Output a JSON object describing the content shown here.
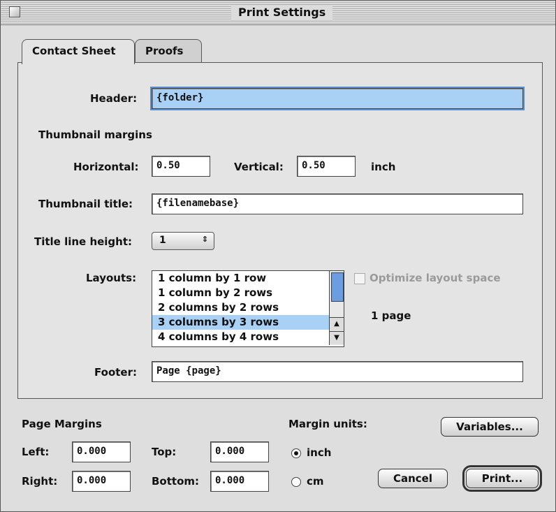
{
  "window": {
    "title": "Print Settings"
  },
  "tabs": [
    {
      "label": "Contact Sheet",
      "active": true
    },
    {
      "label": "Proofs",
      "active": false
    }
  ],
  "form": {
    "header_label": "Header:",
    "header_value": "{folder}",
    "thumb_margins_heading": "Thumbnail margins",
    "horizontal_label": "Horizontal:",
    "horizontal_value": "0.50",
    "vertical_label": "Vertical:",
    "vertical_value": "0.50",
    "margin_unit": "inch",
    "thumb_title_label": "Thumbnail title:",
    "thumb_title_value": "{filenamebase}",
    "title_line_height_label": "Title line height:",
    "title_line_height_value": "1",
    "layouts_label": "Layouts:",
    "layouts": [
      "1 column by 1 row",
      "1 column by 2 rows",
      "2 columns by 2 rows",
      "3 columns by 3 rows",
      "4 columns by 4 rows"
    ],
    "layouts_selected": "3 columns by 3 rows",
    "optimize_label": "Optimize layout space",
    "page_count": "1 page",
    "footer_label": "Footer:",
    "footer_value": "Page {page}"
  },
  "page_margins": {
    "heading": "Page Margins",
    "left_label": "Left:",
    "left_value": "0.000",
    "right_label": "Right:",
    "right_value": "0.000",
    "top_label": "Top:",
    "top_value": "0.000",
    "bottom_label": "Bottom:",
    "bottom_value": "0.000"
  },
  "margin_units": {
    "heading": "Margin units:",
    "inch_label": "inch",
    "cm_label": "cm",
    "selected": "inch"
  },
  "buttons": {
    "variables": "Variables...",
    "cancel": "Cancel",
    "print": "Print..."
  }
}
